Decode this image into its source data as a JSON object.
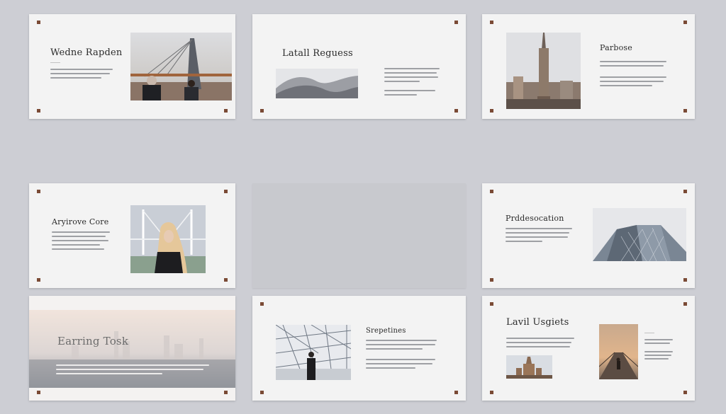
{
  "slides": [
    {
      "title": "Wedne Rapden"
    },
    {
      "title": "Latall Reguess"
    },
    {
      "title": "Parbose"
    },
    {
      "title": "Aryirove Core"
    },
    {
      "title": ""
    },
    {
      "title": "Prddesocation"
    },
    {
      "title": "Earring Tosk"
    },
    {
      "title": "Srepetines"
    },
    {
      "title": "Lavil Usgiets"
    }
  ],
  "colors": {
    "background": "#cdced4",
    "slide": "#f3f3f3",
    "corner_marker": "#7a4a35",
    "text_placeholder": "#9ea0a4"
  },
  "icons": {
    "corner_marker": "square-marker",
    "photos": [
      "bridge-photo",
      "dunes-photo",
      "skyscraper-photo",
      "bridge-woman-photo",
      "glass-building-photo",
      "hazy-skyline-photo",
      "glass-roof-man-photo",
      "cathedral-photo",
      "sunset-bridge-photo"
    ]
  }
}
